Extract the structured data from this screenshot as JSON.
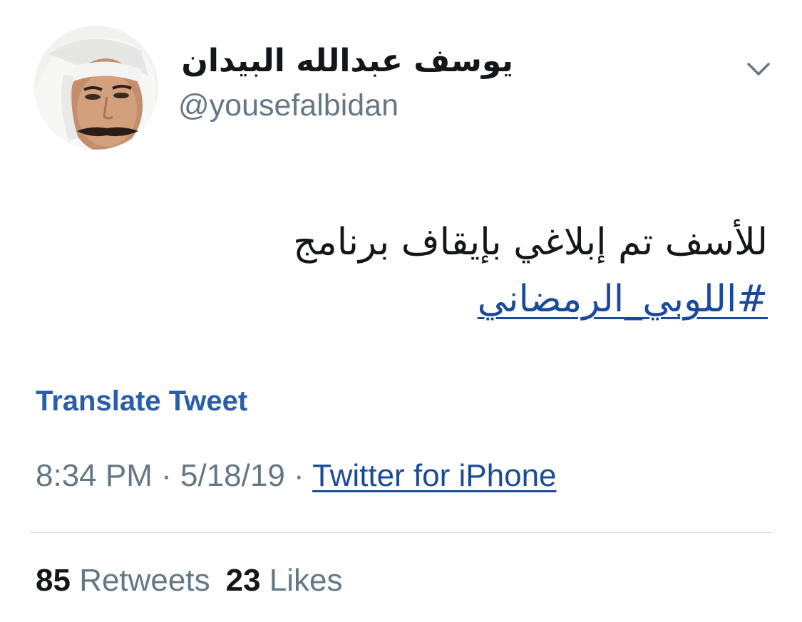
{
  "tweet": {
    "author": {
      "display_name": "يوسف عبدالله البيدان",
      "handle": "@yousefalbidan",
      "avatar_icon": "user-avatar"
    },
    "menu_icon": "chevron-down-icon",
    "text_line_1": "للأسف تم إبلاغي بإيقاف برنامج",
    "hashtag": "#اللوبي_الرمضاني",
    "translate_label": "Translate Tweet",
    "time": "8:34 PM",
    "separator": "·",
    "date": "5/18/19",
    "source": "Twitter for iPhone",
    "stats": {
      "retweets_count": "85",
      "retweets_label": "Retweets",
      "likes_count": "23",
      "likes_label": "Likes"
    }
  },
  "colors": {
    "text_primary": "#14171a",
    "text_secondary": "#657786",
    "link": "#1b4a9b",
    "translate": "#2a5ea8",
    "divider": "#ccd6dd"
  }
}
